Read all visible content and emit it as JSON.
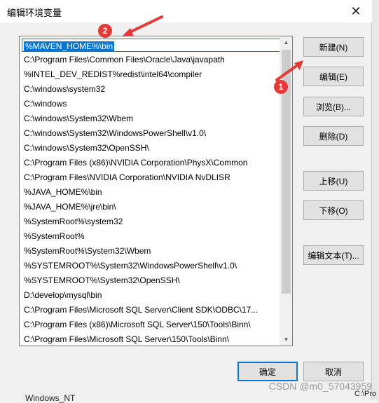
{
  "window": {
    "title": "编辑环境变量",
    "close_glyph": "✕"
  },
  "list": {
    "selected_index": 0,
    "items": [
      "%MAVEN_HOME%\\bin",
      "C:\\Program Files\\Common Files\\Oracle\\Java\\javapath",
      "%INTEL_DEV_REDIST%redist\\intel64\\compiler",
      "C:\\windows\\system32",
      "C:\\windows",
      "C:\\windows\\System32\\Wbem",
      "C:\\windows\\System32\\WindowsPowerShell\\v1.0\\",
      "C:\\windows\\System32\\OpenSSH\\",
      "C:\\Program Files (x86)\\NVIDIA Corporation\\PhysX\\Common",
      "C:\\Program Files\\NVIDIA Corporation\\NVIDIA NvDLISR",
      "%JAVA_HOME%\\bin",
      "%JAVA_HOME%\\jre\\bin\\",
      "%SystemRoot%\\system32",
      "%SystemRoot%",
      "%SystemRoot%\\System32\\Wbem",
      "%SYSTEMROOT%\\System32\\WindowsPowerShell\\v1.0\\",
      "%SYSTEMROOT%\\System32\\OpenSSH\\",
      "D:\\develop\\mysql\\bin",
      "C:\\Program Files\\Microsoft SQL Server\\Client SDK\\ODBC\\17...",
      "C:\\Program Files (x86)\\Microsoft SQL Server\\150\\Tools\\Binn\\",
      "C:\\Program Files\\Microsoft SQL Server\\150\\Tools\\Binn\\"
    ]
  },
  "buttons": {
    "new": "新建(N)",
    "edit": "编辑(E)",
    "browse": "浏览(B)...",
    "delete": "删除(D)",
    "move_up": "上移(U)",
    "move_down": "下移(O)",
    "edit_text": "编辑文本(T)...",
    "ok": "确定",
    "cancel": "取消"
  },
  "annotations": {
    "badge_1": "1",
    "badge_2": "2",
    "color": "#e53935"
  },
  "watermark": "CSDN @m0_57043959",
  "background_fragments": [
    "Windows_NT",
    "C:\\Pro"
  ],
  "colors": {
    "accent": "#0078d7",
    "button_face": "#e1e1e1"
  }
}
